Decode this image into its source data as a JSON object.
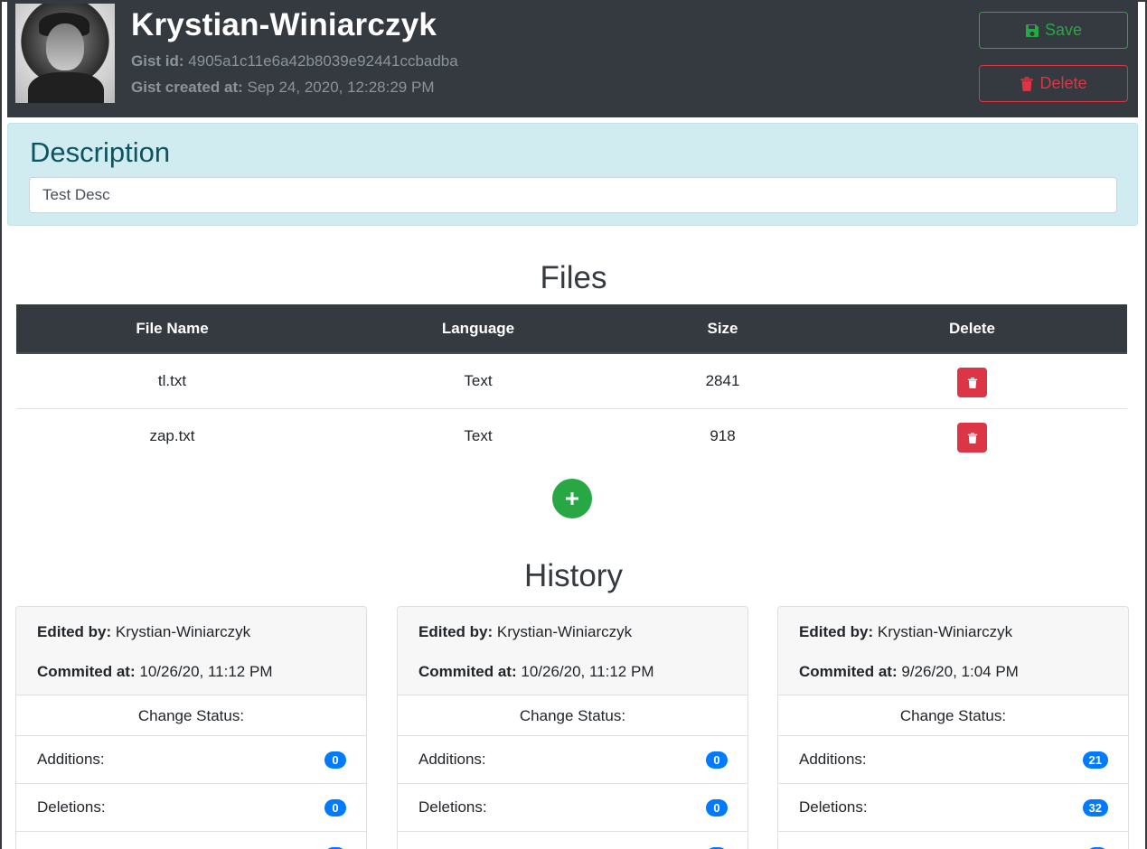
{
  "gist": {
    "owner": "Krystian-Winiarczyk",
    "id_label": "Gist id:",
    "id": "4905a1c11e6a42b8039e92441ccbadba",
    "created_label": "Gist created at:",
    "created_at": "Sep 24, 2020, 12:28:29 PM"
  },
  "actions": {
    "save_label": "Save",
    "delete_label": "Delete"
  },
  "description": {
    "title": "Description",
    "value": "Test Desc"
  },
  "files": {
    "title": "Files",
    "columns": [
      "File Name",
      "Language",
      "Size",
      "Delete"
    ],
    "rows": [
      {
        "name": "tl.txt",
        "language": "Text",
        "size": "2841"
      },
      {
        "name": "zap.txt",
        "language": "Text",
        "size": "918"
      }
    ]
  },
  "history": {
    "title": "History",
    "edited_by_label": "Edited by:",
    "committed_label": "Commited at:",
    "status_label": "Change Status:",
    "additions_label": "Additions:",
    "deletions_label": "Deletions:",
    "entries": [
      {
        "editor": "Krystian-Winiarczyk",
        "committed_at": "10/26/20, 11:12 PM",
        "additions": "0",
        "deletions": "0"
      },
      {
        "editor": "Krystian-Winiarczyk",
        "committed_at": "10/26/20, 11:12 PM",
        "additions": "0",
        "deletions": "0"
      },
      {
        "editor": "Krystian-Winiarczyk",
        "committed_at": "9/26/20, 1:04 PM",
        "additions": "21",
        "deletions": "32"
      }
    ]
  },
  "colors": {
    "header_bg": "#343a40",
    "success": "#28a745",
    "danger": "#dc3545",
    "info_bg": "#d1ecf1",
    "badge": "#007bff"
  },
  "icons": {
    "save": "floppy-disk-icon",
    "delete": "trash-icon",
    "add": "plus-icon"
  }
}
